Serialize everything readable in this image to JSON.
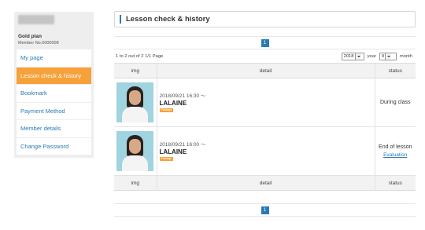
{
  "sidebar": {
    "plan": "Gold plan",
    "member_no": "Member No.0000008",
    "menu": [
      {
        "label": "My page"
      },
      {
        "label": "Lesson check & history"
      },
      {
        "label": "Bookmark"
      },
      {
        "label": "Payment Method"
      },
      {
        "label": "Member details"
      },
      {
        "label": "Change Password"
      }
    ]
  },
  "main": {
    "title": "Lesson check & history",
    "pagination": {
      "current_page": "1"
    },
    "summary": "1 to 2 out of 2 1/1 Page",
    "filter": {
      "year_value": "2018",
      "year_label": "year",
      "month_value": "9",
      "month_label": "month"
    },
    "table": {
      "headers": [
        "img",
        "detail",
        "status"
      ],
      "rows": [
        {
          "datetime": "2018/09/21 16:30 ～",
          "tutor": "LALAINE",
          "badge": "Package",
          "status": "During class",
          "link": ""
        },
        {
          "datetime": "2018/09/21 16:00 ～",
          "tutor": "LALAINE",
          "badge": "Package",
          "status": "End of lesson",
          "link": "Evaluation"
        }
      ]
    }
  },
  "colors": {
    "accent": "#2a7ab3",
    "active_menu": "#f6a13a"
  }
}
